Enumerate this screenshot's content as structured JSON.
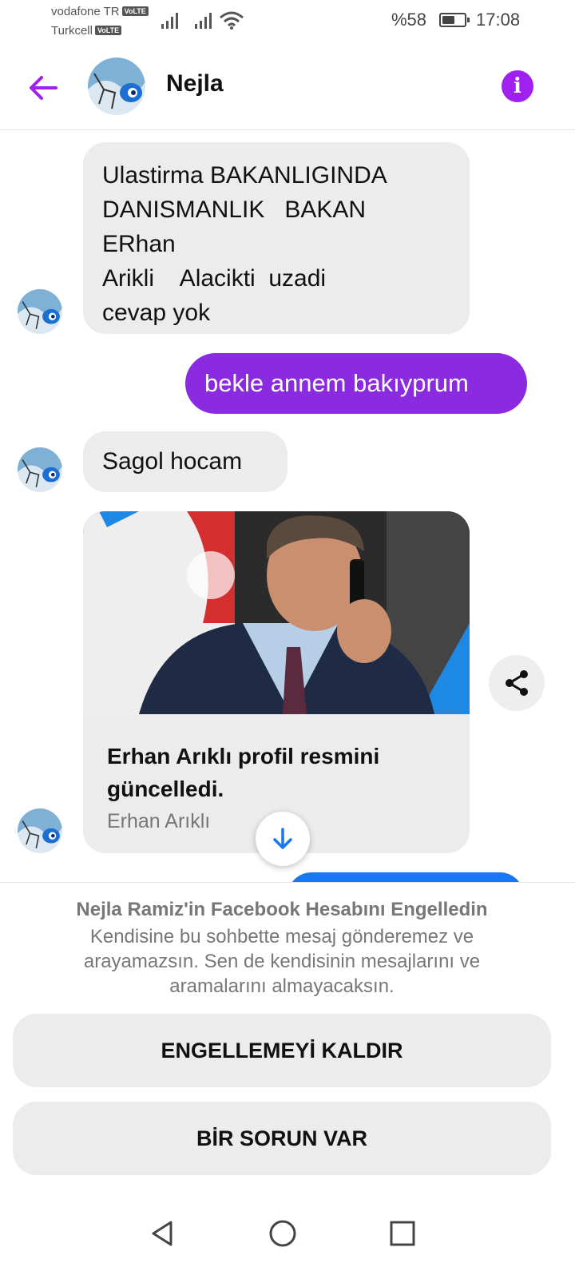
{
  "status_bar": {
    "carrier_1": "vodafone TR",
    "carrier_2": "Turkcell",
    "volte_badge": "VoLTE",
    "battery": "%58",
    "battery_level": 0.58,
    "time": "17:08"
  },
  "header": {
    "contact_name": "Nejla",
    "back_icon": "arrow-left-icon",
    "info_icon": "info-icon"
  },
  "messages": [
    {
      "direction": "incoming",
      "text": "Ulastirma BAKANLIGINDA\nDANISMANLIK   BAKAN\nERhan\nArikli    Alacikti  uzadi\ncevap yok"
    },
    {
      "direction": "outgoing",
      "text": "bekle annem bakıyprum"
    },
    {
      "direction": "incoming",
      "text": "Sagol hocam"
    }
  ],
  "link_card": {
    "title": "Erhan Arıklı profil resmini güncelledi.",
    "subtitle": "Erhan Arıklı"
  },
  "blocked_panel": {
    "title": "Nejla Ramiz'in Facebook Hesabını Engelledin",
    "description": "Kendisine bu sohbette mesaj gönderemez ve arayamazsın. Sen de kendisinin mesajlarını ve aramalarını almayacaksın.",
    "unblock_button": "ENGELLEMEYİ KALDIR",
    "problem_button": "BİR SORUN VAR"
  },
  "colors": {
    "accent": "#a020f0",
    "outgoing_bubble": "#8a2be2",
    "incoming_bubble": "#ececec",
    "peek_bubble": "#1877f2"
  }
}
